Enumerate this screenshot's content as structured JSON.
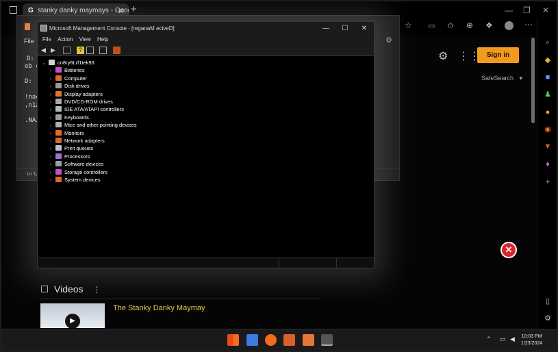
{
  "browser": {
    "tab_title": "stanky danky maymays - Google",
    "tab_close": "✕",
    "new_tab": "+",
    "sign_in": "Sign in",
    "safesearch": "SafeSearch"
  },
  "notepad": {
    "menu_file": "File",
    "lines": [
      "D:",
      "eb c",
      "D:",
      "!nac",
      ",n1a",
      ".NAJ"
    ],
    "status": "Ln 1,"
  },
  "mmc": {
    "title": "Microsoft Management Console - [reganaM eciveD]",
    "menu": [
      "File",
      "Action",
      "View",
      "Help"
    ],
    "root": "cn8ry6Lrf1tek93",
    "devices": [
      {
        "label": "Batteries",
        "color": "#c84fc8"
      },
      {
        "label": "Computer",
        "color": "#d6692b"
      },
      {
        "label": "Disk drives",
        "color": "#9a9a9a"
      },
      {
        "label": "Display adapters",
        "color": "#e0762e"
      },
      {
        "label": "DVD/CD-ROM drives",
        "color": "#a8a8a8"
      },
      {
        "label": "IDE ATA/ATAPI controllers",
        "color": "#b8b8b8"
      },
      {
        "label": "Keyboards",
        "color": "#9c9c9c"
      },
      {
        "label": "Mice and other pointing devices",
        "color": "#b0b0b0"
      },
      {
        "label": "Monitors",
        "color": "#e06a2a"
      },
      {
        "label": "Network adapters",
        "color": "#d6692b"
      },
      {
        "label": "Print queues",
        "color": "#c0c0c0"
      },
      {
        "label": "Processors",
        "color": "#a070d0"
      },
      {
        "label": "Software devices",
        "color": "#9c9c9c"
      },
      {
        "label": "Storage controllers",
        "color": "#c84fc8"
      },
      {
        "label": "System devices",
        "color": "#d6692b"
      }
    ]
  },
  "page": {
    "videos": "Videos",
    "video_title": "The Stanky Danky Maymay"
  },
  "taskbar": {
    "time": "10:03 PM",
    "date": "1/23/2024"
  }
}
